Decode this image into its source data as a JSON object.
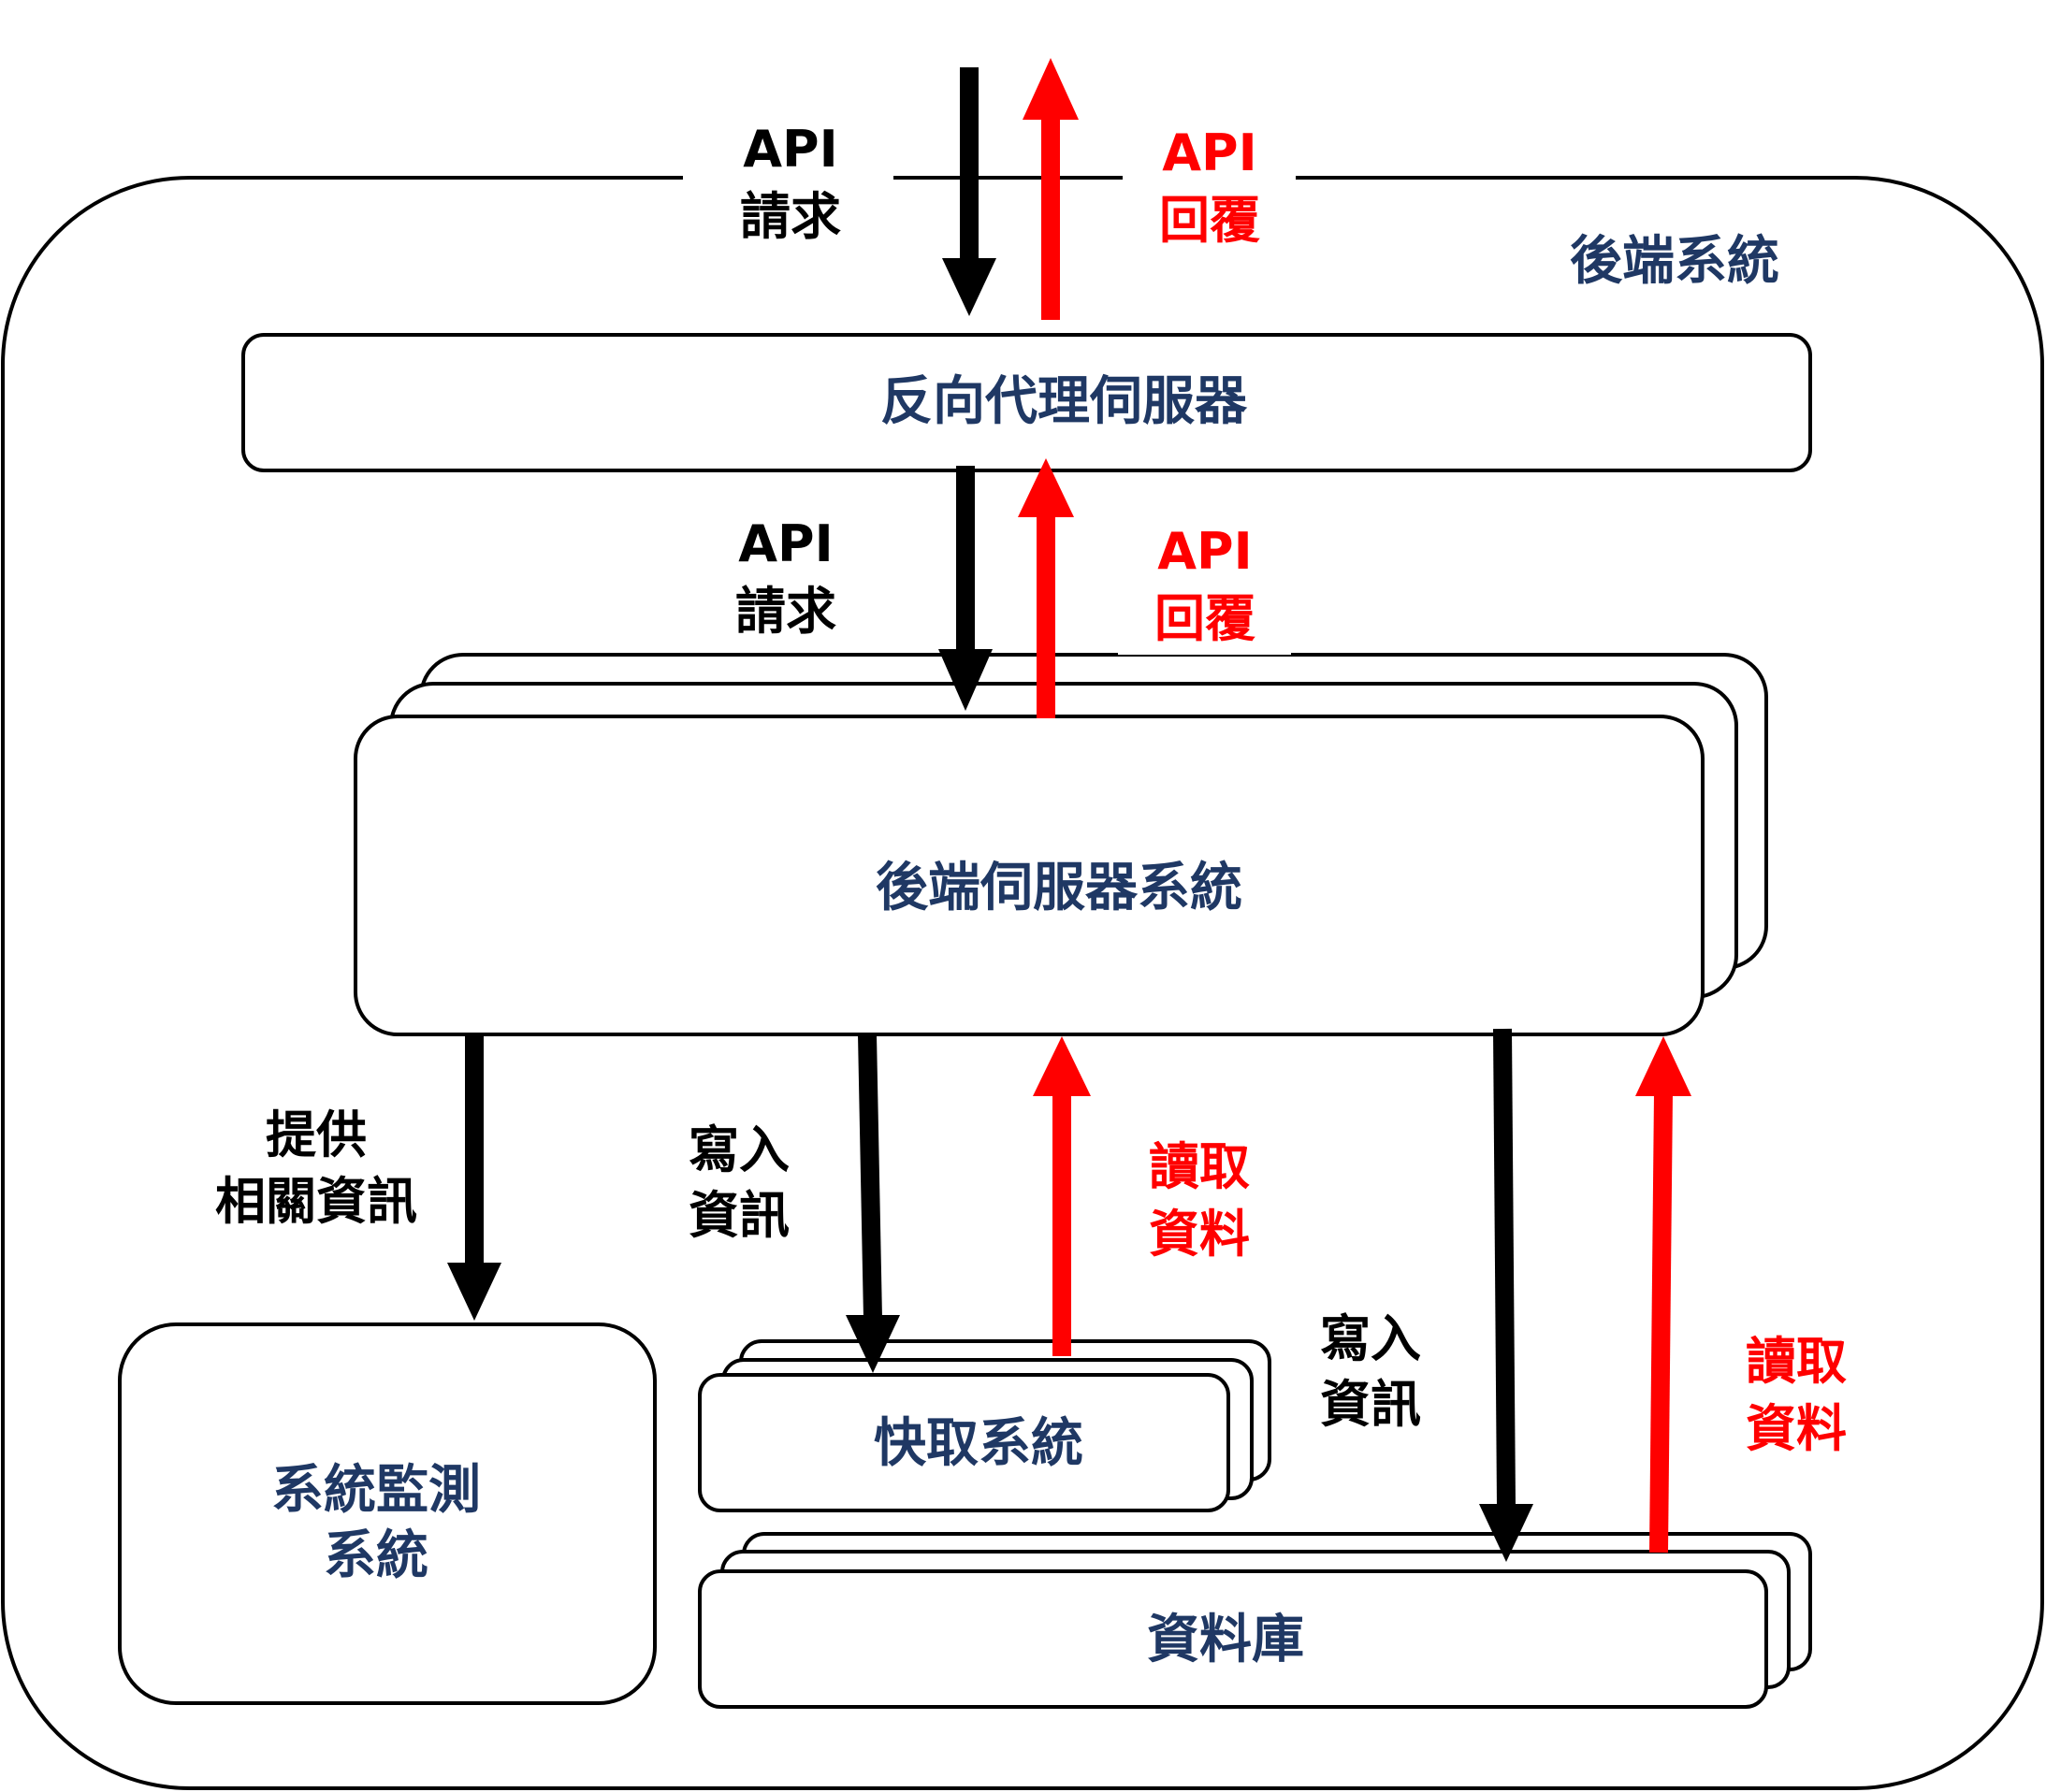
{
  "colors": {
    "box_text": "#1F3864",
    "request": "#000000",
    "response": "#FF0000",
    "stroke": "#000000"
  },
  "container": {
    "title": "後端系統"
  },
  "nodes": {
    "reverse_proxy": "反向代理伺服器",
    "backend_servers": "後端伺服器系統",
    "monitoring": {
      "line1": "系統監測",
      "line2": "系統"
    },
    "cache": "快取系統",
    "database": "資料庫"
  },
  "flows": {
    "top_request": {
      "line1": "API",
      "line2": "請求"
    },
    "top_response": {
      "line1": "API",
      "line2": "回覆"
    },
    "mid_request": {
      "line1": "API",
      "line2": "請求"
    },
    "mid_response": {
      "line1": "API",
      "line2": "回覆"
    },
    "provide_info": {
      "line1": "提供",
      "line2": "相關資訊"
    },
    "cache_write": {
      "line1": "寫入",
      "line2": "資訊"
    },
    "cache_read": {
      "line1": "讀取",
      "line2": "資料"
    },
    "db_write": {
      "line1": "寫入",
      "line2": "資訊"
    },
    "db_read": {
      "line1": "讀取",
      "line2": "資料"
    }
  }
}
